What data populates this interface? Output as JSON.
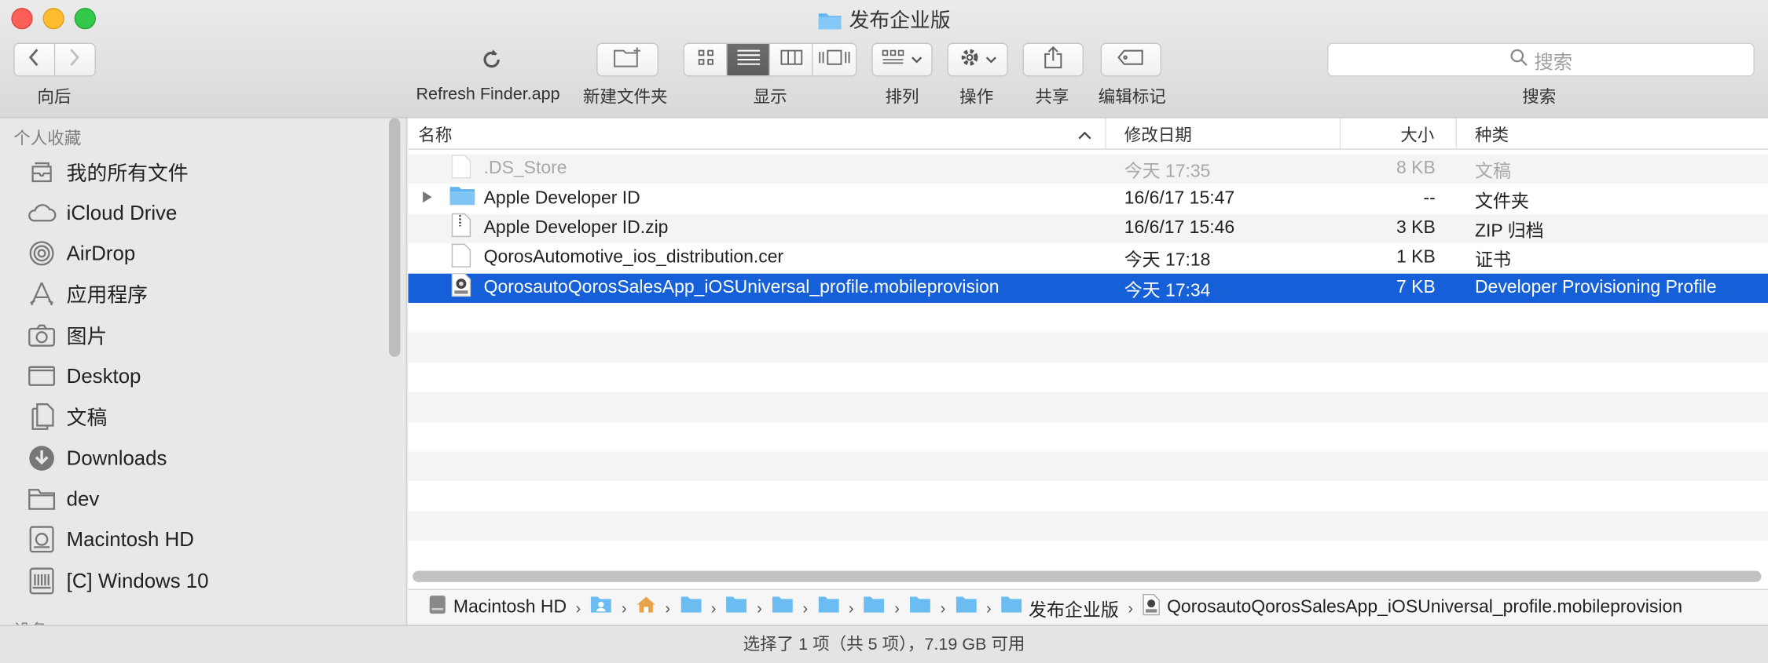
{
  "window": {
    "title": "发布企业版"
  },
  "toolbar": {
    "back_label": "向后",
    "refresh_label": "Refresh Finder.app",
    "new_folder_label": "新建文件夹",
    "view_label": "显示",
    "arrange_label": "排列",
    "action_label": "操作",
    "share_label": "共享",
    "tags_label": "编辑标记",
    "search_label": "搜索",
    "search_placeholder": "搜索"
  },
  "sidebar": {
    "section_favorites": "个人收藏",
    "items": [
      {
        "label": "我的所有文件",
        "icon": "all-files-icon"
      },
      {
        "label": "iCloud Drive",
        "icon": "cloud-icon"
      },
      {
        "label": "AirDrop",
        "icon": "airdrop-icon"
      },
      {
        "label": "应用程序",
        "icon": "applications-icon"
      },
      {
        "label": "图片",
        "icon": "camera-icon"
      },
      {
        "label": "Desktop",
        "icon": "desktop-icon"
      },
      {
        "label": "文稿",
        "icon": "documents-icon"
      },
      {
        "label": "Downloads",
        "icon": "downloads-icon"
      },
      {
        "label": "dev",
        "icon": "folder-icon"
      },
      {
        "label": "Macintosh HD",
        "icon": "harddisk-icon"
      },
      {
        "label": "[C] Windows 10",
        "icon": "windows-disk-icon"
      }
    ],
    "section_devices": "设备"
  },
  "columns": {
    "name": "名称",
    "date": "修改日期",
    "size": "大小",
    "kind": "种类"
  },
  "files": [
    {
      "name": ".DS_Store",
      "date": "今天 17:35",
      "size": "8 KB",
      "kind": "文稿",
      "icon": "blank-file-icon"
    },
    {
      "name": "Apple Developer ID",
      "date": "16/6/17 15:47",
      "size": "--",
      "kind": "文件夹",
      "icon": "folder-icon"
    },
    {
      "name": "Apple Developer ID.zip",
      "date": "16/6/17 15:46",
      "size": "3 KB",
      "kind": "ZIP 归档",
      "icon": "zip-file-icon"
    },
    {
      "name": "QorosAutomotive_ios_distribution.cer",
      "date": "今天 17:18",
      "size": "1 KB",
      "kind": "证书",
      "icon": "blank-file-icon"
    },
    {
      "name": "QorosautoQorosSalesApp_iOSUniversal_profile.mobileprovision",
      "date": "今天 17:34",
      "size": "7 KB",
      "kind": "Developer Provisioning Profile",
      "icon": "provision-file-icon"
    }
  ],
  "pathbar": {
    "items": [
      "Macintosh HD",
      "",
      "",
      "",
      "",
      "",
      "",
      "",
      "",
      "发布企业版",
      "QorosautoQorosSalesApp_iOSUniversal_profile.mobileprovision"
    ]
  },
  "status": {
    "text": "选择了 1 项（共 5 项），7.19 GB 可用"
  }
}
